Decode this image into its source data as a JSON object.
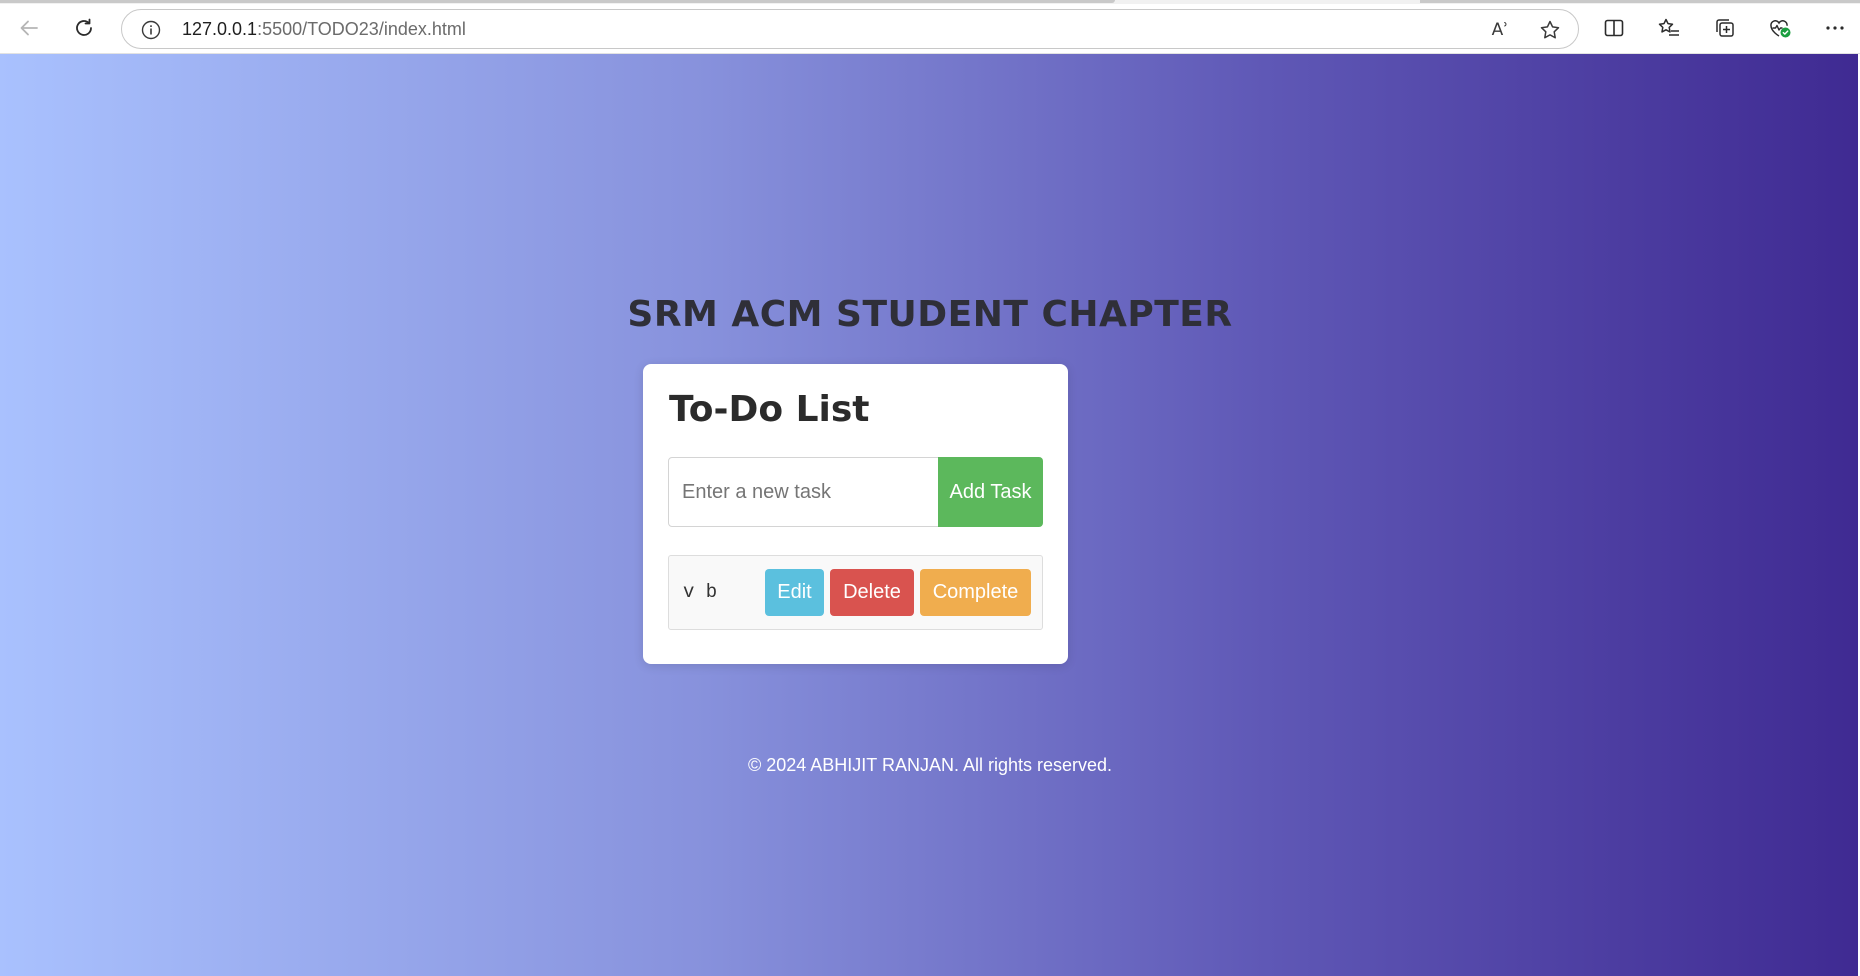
{
  "browser": {
    "url_host": "127.0.0.1",
    "url_path": ":5500/TODO23/index.html",
    "read_aloud_label": "Aʾ",
    "icons": {
      "back": "back-arrow-icon",
      "refresh": "refresh-icon",
      "info": "info-icon",
      "read_aloud": "read-aloud-icon",
      "favorite": "star-icon",
      "split_screen": "split-screen-icon",
      "favorites": "favorites-list-icon",
      "collections": "collections-icon",
      "health": "browser-essentials-icon",
      "more": "more-icon"
    }
  },
  "page": {
    "heading": "SRM ACM STUDENT CHAPTER",
    "card": {
      "title": "To-Do List",
      "input_placeholder": "Enter a new task",
      "input_value": "",
      "add_button": "Add Task"
    },
    "tasks": [
      {
        "text": "v b",
        "edit": "Edit",
        "delete": "Delete",
        "complete": "Complete"
      }
    ],
    "footer": "© 2024 ABHIJIT RANJAN. All rights reserved."
  },
  "colors": {
    "gradient_start": "#a9c1fe",
    "gradient_end": "#3f2a92",
    "add_button": "#5cb85c",
    "edit_button": "#5bc0de",
    "delete_button": "#d9534f",
    "complete_button": "#f0ad4e"
  }
}
